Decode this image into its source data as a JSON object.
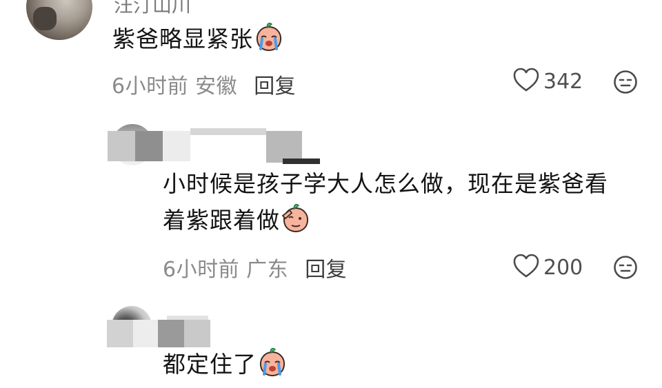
{
  "comments": [
    {
      "username": "汪汀山川",
      "text": "紫爸略显紧张",
      "emoji": "crying-peach-emoji",
      "time": "6小时前",
      "location": "安徽",
      "reply_label": "回复",
      "likes": "342"
    },
    {
      "text_line1": "小时候是孩子学大人怎么做，现在是紫爸看",
      "text_line2": "着紫跟着做",
      "emoji": "salute-peach-emoji",
      "time": "6小时前",
      "location": "广东",
      "reply_label": "回复",
      "likes": "200"
    },
    {
      "text": "都定住了",
      "emoji": "crying-peach-emoji"
    }
  ],
  "icons": {
    "like": "heart-outline-icon",
    "more": "neutral-face-icon"
  },
  "colors": {
    "text": "#141414",
    "meta": "#8a8a8a",
    "reply": "#3d3d3d",
    "peach": "#f6b29a",
    "leaf": "#3fbf68"
  }
}
